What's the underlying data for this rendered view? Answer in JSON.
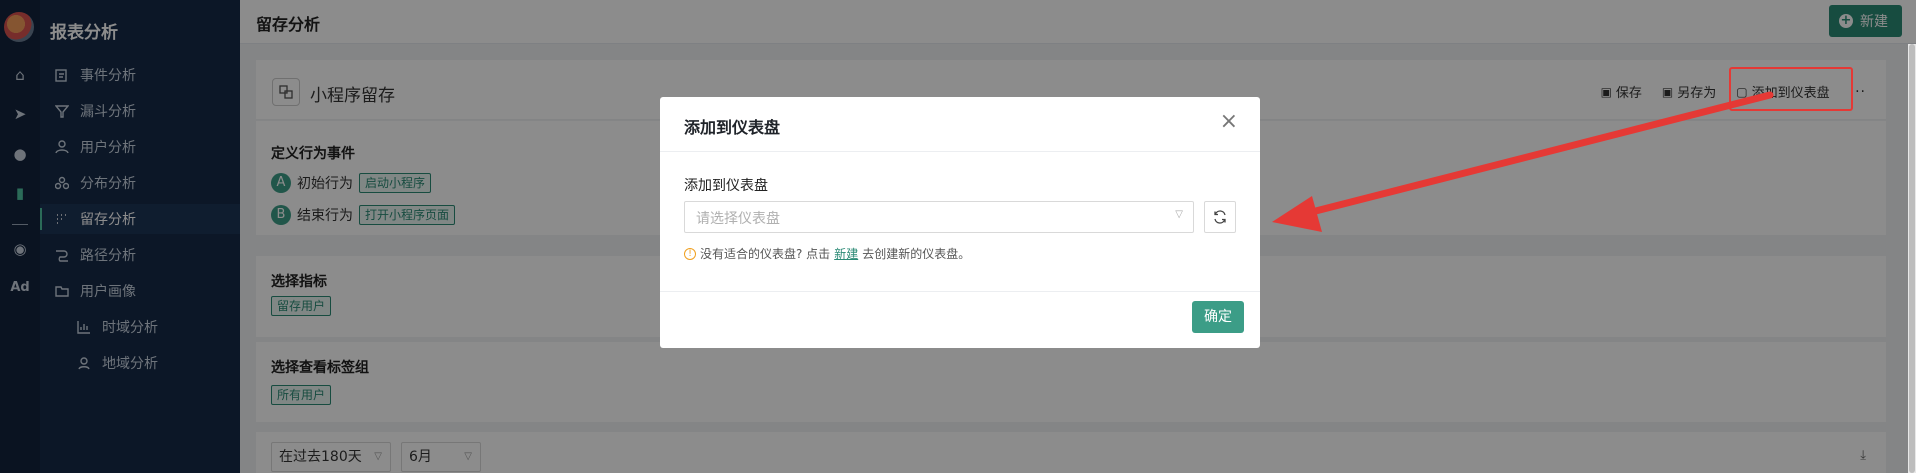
{
  "sidebar": {
    "title": "报表分析",
    "items": [
      {
        "label": "事件分析",
        "icon": "edit-icon"
      },
      {
        "label": "漏斗分析",
        "icon": "funnel-icon"
      },
      {
        "label": "用户分析",
        "icon": "user-icon"
      },
      {
        "label": "分布分析",
        "icon": "distribution-icon"
      },
      {
        "label": "留存分析",
        "icon": "retention-icon",
        "active": true
      },
      {
        "label": "路径分析",
        "icon": "path-icon"
      },
      {
        "label": "用户画像",
        "icon": "folder-icon"
      },
      {
        "label": "时域分析",
        "icon": "bar-chart-icon",
        "sub": true
      },
      {
        "label": "地域分析",
        "icon": "location-icon",
        "sub": true
      }
    ]
  },
  "rail": {
    "items": [
      "home-icon",
      "send-icon",
      "user-icon",
      "bar-chart-icon",
      "wechat-icon"
    ],
    "ad_label": "Ad"
  },
  "header": {
    "title": "留存分析",
    "new_button": "新建"
  },
  "chart": {
    "name": "小程序留存",
    "toolbar": {
      "save": "保存",
      "save_as": "另存为",
      "add_to_dashboard": "添加到仪表盘",
      "more": "···"
    }
  },
  "sections": {
    "behavior_title": "定义行为事件",
    "start": {
      "badge": "A",
      "label": "初始行为",
      "tag": "启动小程序"
    },
    "end": {
      "badge": "B",
      "label": "结束行为",
      "tag": "打开小程序页面"
    },
    "metric_title": "选择指标",
    "metric_tag": "留存用户",
    "group_title": "选择查看标签组",
    "group_tag": "所有用户"
  },
  "filters": {
    "range": "在过去180天",
    "month": "6月"
  },
  "modal": {
    "title": "添加到仪表盘",
    "field_label": "添加到仪表盘",
    "select_placeholder": "请选择仪表盘",
    "hint_before": "没有适合的仪表盘? 点击",
    "hint_link": "新建",
    "hint_after": "去创建新的仪表盘。",
    "ok_button": "确定"
  },
  "colors": {
    "accent": "#3c9d87",
    "sidebar_bg": "#162a47",
    "annotation": "#e53935"
  }
}
